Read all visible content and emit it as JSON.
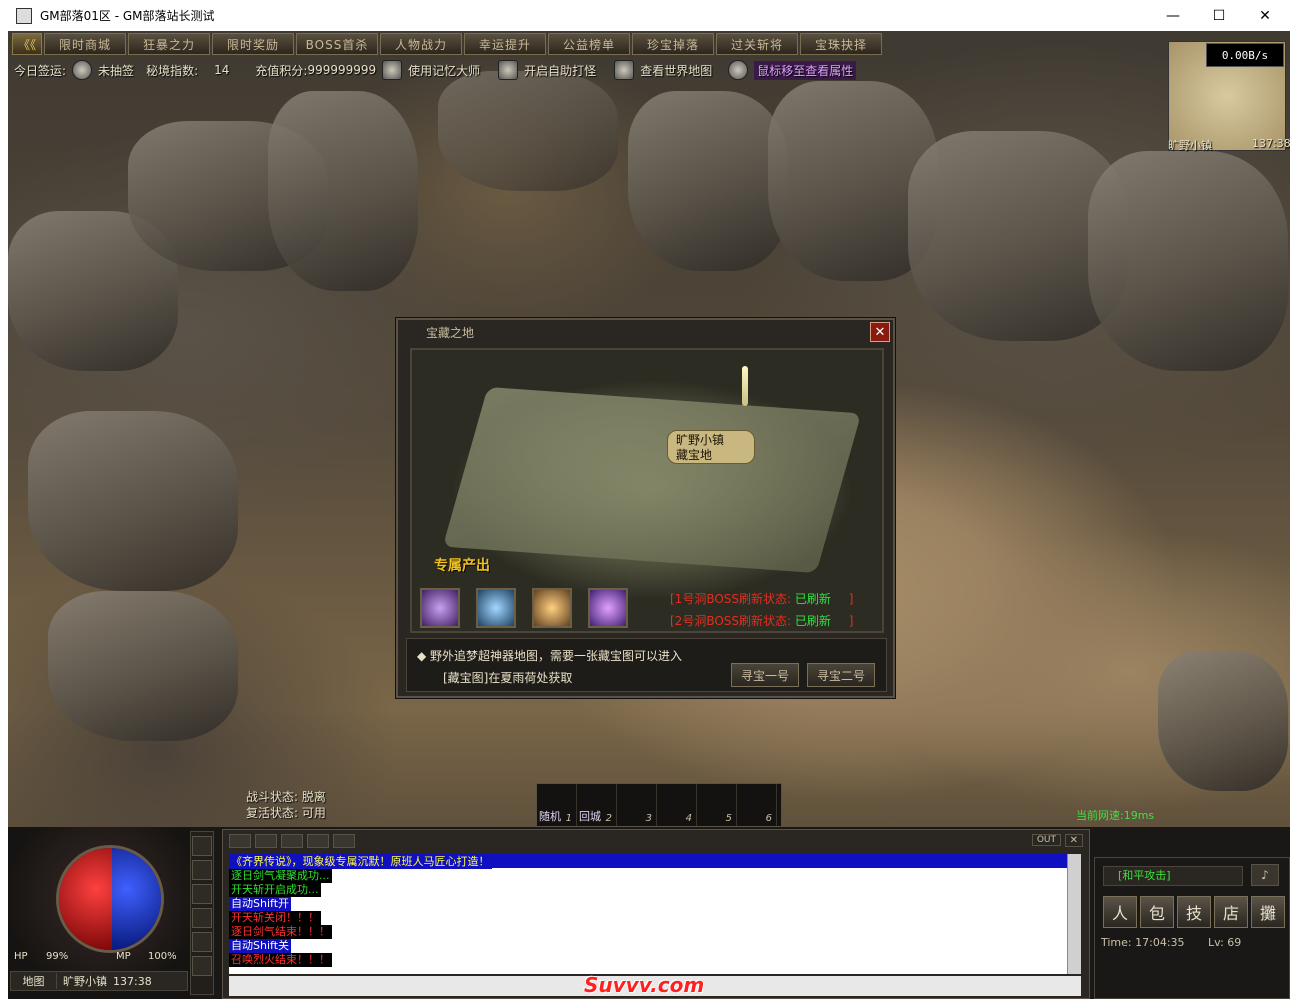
{
  "window": {
    "title": "GM部落01区 - GM部落站长测试",
    "minimize": "—",
    "maximize": "☐",
    "close": "✕"
  },
  "tabs": [
    "限时商城",
    "狂暴之力",
    "限时奖励",
    "BOSS首杀",
    "人物战力",
    "幸运提升",
    "公益榜单",
    "珍宝掉落",
    "过关斩将",
    "宝珠抉择"
  ],
  "tab_back": "《《",
  "info": {
    "sign_label": "今日签运:",
    "sign_value": "未抽签",
    "secret_label": "秘境指数:",
    "secret_value": "14",
    "recharge_label": "充值积分:",
    "recharge_value": "999999999",
    "memory": "使用记忆大师",
    "auto": "开启自助打怪",
    "worldmap": "查看世界地图",
    "hover": "鼠标移至查看属性"
  },
  "minimap": {
    "speed": "0.00B/s",
    "location": "旷野小镇",
    "coords": "137:38"
  },
  "dialog": {
    "title": "宝藏之地",
    "bubble_line1": "旷野小镇",
    "bubble_line2": "藏宝地",
    "exclusive": "专属产出",
    "boss1_label": "[1号洞BOSS刷新状态:",
    "boss1_value": "已刷新",
    "boss1_end": "]",
    "boss2_label": "[2号洞BOSS刷新状态:",
    "boss2_value": "已刷新",
    "boss2_end": "]",
    "desc1": "野外追梦超神器地图，需要一张藏宝图可以进入",
    "desc2": "[藏宝图]在夏雨荷处获取",
    "btn1": "寻宝一号",
    "btn2": "寻宝二号"
  },
  "status": {
    "battle": "战斗状态: 脱离",
    "revive": "复活状态: 可用"
  },
  "quickbar": {
    "slot1": "随机",
    "slot2": "回城",
    "n1": "1",
    "n2": "2",
    "n3": "3",
    "n4": "4",
    "n5": "5",
    "n6": "6"
  },
  "ping": "当前网速:19ms",
  "hud": {
    "hp_label": "HP",
    "hp_value": "99%",
    "mp_label": "MP",
    "mp_value": "100%",
    "map_label": "地图",
    "map_name": "旷野小镇",
    "map_coords": "137:38"
  },
  "chat": {
    "out": "OUT",
    "x": "✕",
    "lines": [
      {
        "text": "《齐界传说》，现象级专属沉默！原班人马匠心打造！",
        "color": "#ffff40",
        "bg": "#1010c0"
      },
      {
        "text": "逐日剑气凝聚成功...",
        "color": "#30e030",
        "bg": "#000000"
      },
      {
        "text": "开天斩开启成功...",
        "color": "#30e030",
        "bg": "#000000"
      },
      {
        "text": "自动Shift开",
        "color": "#ffffff",
        "bg": "#1010c0"
      },
      {
        "text": "开天斩关闭！！！",
        "color": "#ff3030",
        "bg": "#000000"
      },
      {
        "text": "逐日剑气结束！！！",
        "color": "#ff3030",
        "bg": "#000000"
      },
      {
        "text": "自动Shift关",
        "color": "#ffffff",
        "bg": "#1010c0"
      },
      {
        "text": "召唤烈火结束！！！",
        "color": "#ff3030",
        "bg": "#000000"
      }
    ]
  },
  "rpanel": {
    "mode": "[和平攻击]",
    "btn_char": "人",
    "btn_bag": "包",
    "btn_skill": "技",
    "btn_shop": "店",
    "btn_stall": "攤",
    "time": "Time: 17:04:35",
    "lv": "Lv: 69",
    "vol": "♪"
  },
  "watermark": "Suvvv.com",
  "colors": {
    "boss_red": "#e03020",
    "green": "#30e040",
    "chat_blue": "#1010c0"
  }
}
